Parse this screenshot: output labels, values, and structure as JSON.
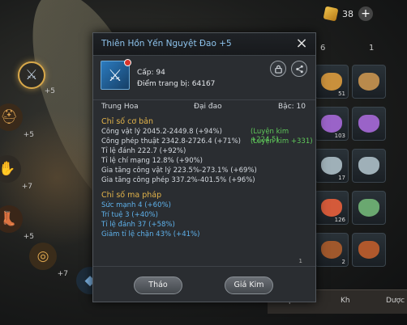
{
  "topbar": {
    "coin_count": "38",
    "plus": "+"
  },
  "side_slots": [
    {
      "level": "+5"
    },
    {
      "level": "+5"
    },
    {
      "level": "+7"
    },
    {
      "level": "+5"
    },
    {
      "level": "+7"
    }
  ],
  "modal": {
    "title": "Thiên Hồn Yến Nguyệt Đao +5",
    "close": "×",
    "level_text": "Cấp: 94",
    "score_text": "Điểm trang bị: 64167",
    "faction": "Trung Hoa",
    "weapon_type": "Đại đao",
    "tier": "Bậc: 10",
    "basic_title": "Chỉ số cơ bản",
    "basic_stats": [
      "Công vật lý    2045.2-2449.8 (+94%)",
      "Công phép thuật    2342.8-2726.4 (+71%)",
      "Tỉ lệ đánh    222.7 (+92%)",
      "Tỉ lệ chí mạng    12.8% (+90%)",
      "Gia tăng công vật lý    223.5%-273.1% (+69%)",
      "Gia tăng công phép    337.2%-401.5% (+96%)"
    ],
    "refine_physical": "(Luyện kim +224.5)",
    "refine_magic": "(Luyện kim +331)",
    "magic_title": "Chỉ số ma pháp",
    "magic_stats": [
      "Sức mạnh 4 (+60%)",
      "Trí tuệ 3 (+40%)",
      "Tỉ lệ đánh 37 (+58%)",
      "Giảm tỉ lệ chặn 43% (+41%)"
    ],
    "btn_unequip": "Tháo",
    "btn_refine": "Giá Kim",
    "corner_num": "1"
  },
  "inventory": {
    "top_nums": [
      "6",
      "1"
    ],
    "cells": [
      {
        "num": "51",
        "color": "#c9903c"
      },
      {
        "num": "103",
        "color": "#9a63c8"
      },
      {
        "num": "17",
        "color": "#9fb0b8"
      },
      {
        "num": "126",
        "color": "#d45a3a"
      },
      {
        "num": "2",
        "color": "#a0582c"
      },
      {
        "num": "",
        "color": "#b98a4c"
      },
      {
        "num": "",
        "color": "#9a63c8"
      },
      {
        "num": "",
        "color": "#9fb0b8"
      },
      {
        "num": "",
        "color": "#6aa870"
      },
      {
        "num": "",
        "color": "#b0582c"
      }
    ],
    "tab_left": "iep",
    "tab_mid": "Kh",
    "tab_right": "Dược"
  },
  "colors": {
    "title_blue": "#8ec3ec",
    "section_gold": "#e2b34a",
    "refine_green": "#5fc85a",
    "magic_blue": "#5fb2ec"
  }
}
